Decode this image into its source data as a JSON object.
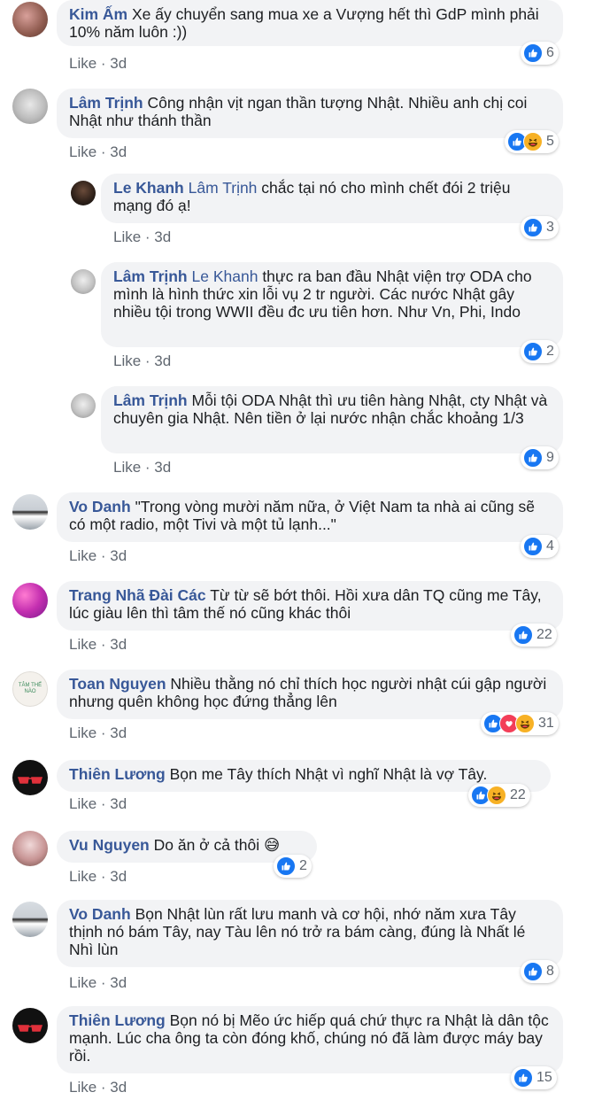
{
  "comments": [
    {
      "author": "Kim Ấm",
      "text": "Xe ấy chuyển sang mua xe a Vượng hết thì GdP mình phải 10% năm luôn :))",
      "like": "Like",
      "time": "3d",
      "count": "6"
    },
    {
      "author": "Lâm Trịnh",
      "text": "Công nhận vịt ngan thần tượng Nhật. Nhiều anh chị coi Nhật như thánh thần",
      "like": "Like",
      "time": "3d",
      "count": "5"
    },
    {
      "author": "Le Khanh",
      "tag": "Lâm Trịnh",
      "text": "chắc tại nó cho mình chết đói 2 triệu mạng đó ạ!",
      "like": "Like",
      "time": "3d",
      "count": "3"
    },
    {
      "author": "Lâm Trịnh",
      "tag": "Le Khanh",
      "text": "thực ra ban đầu Nhật viện trợ ODA cho mình là hình thức xin lỗi vụ 2 tr người. Các nước Nhật gây nhiều tội trong WWII đều đc ưu tiên hơn. Như Vn, Phi, Indo",
      "like": "Like",
      "time": "3d",
      "count": "2"
    },
    {
      "author": "Lâm Trịnh",
      "text": "Mỗi tội ODA Nhật thì ưu tiên hàng Nhật, cty Nhật và chuyên gia Nhật. Nên tiền ở lại nước nhận chắc khoảng 1/3",
      "like": "Like",
      "time": "3d",
      "count": "9"
    },
    {
      "author": "Vo Danh",
      "text": "\"Trong vòng mười năm nữa, ở Việt Nam ta nhà ai cũng sẽ có một radio, một Tivi và một tủ lạnh...\"",
      "like": "Like",
      "time": "3d",
      "count": "4"
    },
    {
      "author": "Trang Nhã Đài Các",
      "text": "Từ từ sẽ bớt thôi. Hồi xưa dân TQ cũng me Tây, lúc giàu lên thì tâm thế nó cũng khác thôi",
      "like": "Like",
      "time": "3d",
      "count": "22"
    },
    {
      "author": "Toan Nguyen",
      "text": "Nhiều thằng nó chỉ thích học người nhật cúi gập người nhưng quên không học đứng thẳng lên",
      "like": "Like",
      "time": "3d",
      "count": "31",
      "avatar_text": "TÂM THẾ NÀO"
    },
    {
      "author": "Thiên Lương",
      "text": "Bọn me Tây thích Nhật vì nghĩ Nhật là vợ Tây.",
      "like": "Like",
      "time": "3d",
      "count": "22"
    },
    {
      "author": "Vu Nguyen",
      "text": "Do ăn ở cả thôi 😅",
      "like": "Like",
      "time": "3d",
      "count": "2"
    },
    {
      "author": "Vo Danh",
      "text": "Bọn Nhật lùn rất lưu manh và cơ hội, nhớ năm xưa Tây thịnh nó bám Tây, nay Tàu lên nó trở ra bám càng, đúng là Nhất lé Nhì lùn",
      "like": "Like",
      "time": "3d",
      "count": "8"
    },
    {
      "author": "Thiên Lương",
      "text": "Bọn nó bị Mẽo ức hiếp quá chứ thực ra Nhật là dân tộc mạnh. Lúc cha ông ta còn đóng khố, chúng nó đã làm được máy bay rồi.",
      "like": "Like",
      "time": "3d",
      "count": "15"
    }
  ],
  "colors": {
    "link": "#385898",
    "bubble": "#f2f3f5",
    "like": "#1877f2",
    "haha": "#f7b125",
    "love": "#f33e58"
  }
}
